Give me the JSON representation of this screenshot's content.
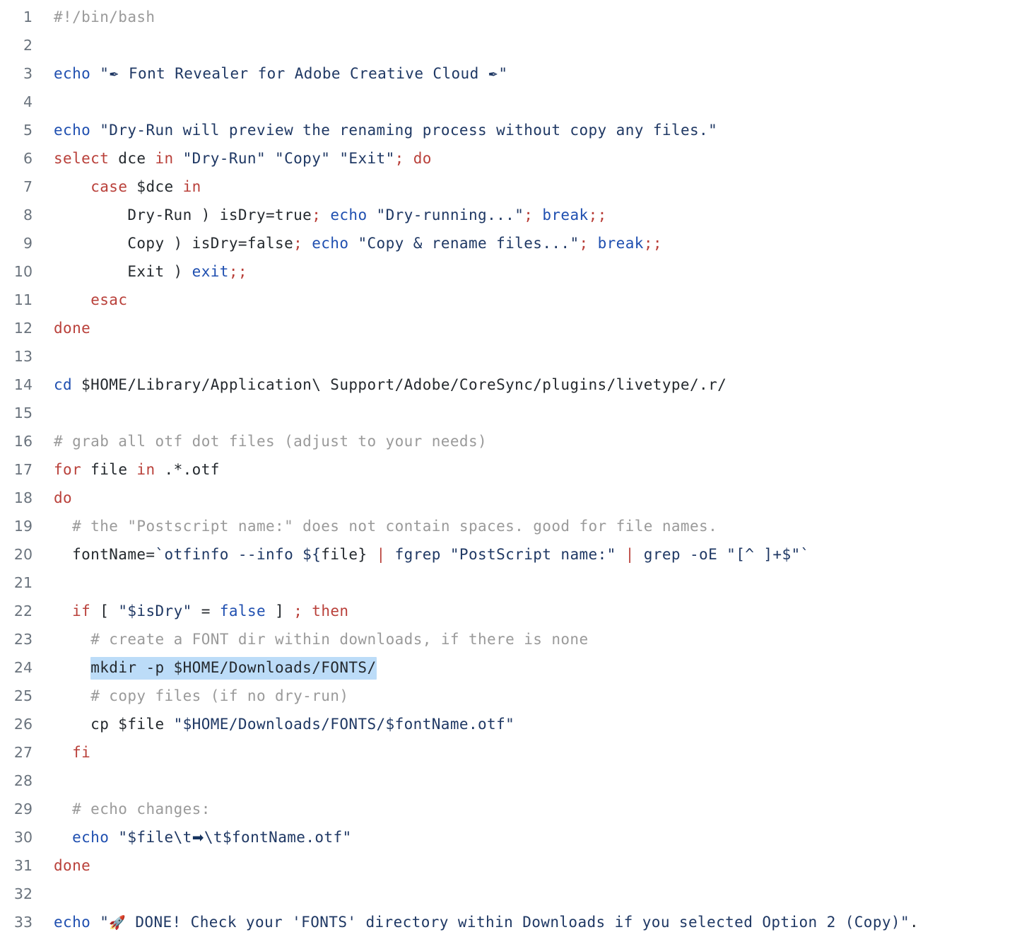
{
  "editor": {
    "name": "code-snippet-viewer",
    "language": "bash",
    "background_color": "#ffffff",
    "gutter_color": "#6a737d",
    "selection_color": "#bcdcf8",
    "colors": {
      "keyword": "#b9403a",
      "builtin": "#1f4fb0",
      "string": "#1f3864",
      "comment": "#9a9a9a",
      "plain": "#24292e",
      "punctuation": "#b9403a"
    },
    "selected_line": 24,
    "total_lines": 33
  },
  "lines": [
    {
      "n": "1",
      "text": "#!/bin/bash"
    },
    {
      "n": "2",
      "text": ""
    },
    {
      "n": "3",
      "text": "echo \"✒ Font Revealer for Adobe Creative Cloud ✒\""
    },
    {
      "n": "4",
      "text": ""
    },
    {
      "n": "5",
      "text": "echo \"Dry-Run will preview the renaming process without copy any files.\""
    },
    {
      "n": "6",
      "text": "select dce in \"Dry-Run\" \"Copy\" \"Exit\"; do"
    },
    {
      "n": "7",
      "text": "    case $dce in"
    },
    {
      "n": "8",
      "text": "        Dry-Run ) isDry=true; echo \"Dry-running...\"; break;;"
    },
    {
      "n": "9",
      "text": "        Copy ) isDry=false; echo \"Copy & rename files...\"; break;;"
    },
    {
      "n": "10",
      "text": "        Exit ) exit;;"
    },
    {
      "n": "11",
      "text": "    esac"
    },
    {
      "n": "12",
      "text": "done"
    },
    {
      "n": "13",
      "text": ""
    },
    {
      "n": "14",
      "text": "cd $HOME/Library/Application\\ Support/Adobe/CoreSync/plugins/livetype/.r/"
    },
    {
      "n": "15",
      "text": ""
    },
    {
      "n": "16",
      "text": "# grab all otf dot files (adjust to your needs)"
    },
    {
      "n": "17",
      "text": "for file in .*.otf"
    },
    {
      "n": "18",
      "text": "do"
    },
    {
      "n": "19",
      "text": "  # the \"Postscript name:\" does not contain spaces. good for file names."
    },
    {
      "n": "20",
      "text": "  fontName=`otfinfo --info ${file} | fgrep \"PostScript name:\" | grep -oE \"[^ ]+$\"`"
    },
    {
      "n": "21",
      "text": ""
    },
    {
      "n": "22",
      "text": "  if [ \"$isDry\" = false ] ; then"
    },
    {
      "n": "23",
      "text": "    # create a FONT dir within downloads, if there is none"
    },
    {
      "n": "24",
      "text": "    mkdir -p $HOME/Downloads/FONTS/"
    },
    {
      "n": "25",
      "text": "    # copy files (if no dry-run)"
    },
    {
      "n": "26",
      "text": "    cp $file \"$HOME/Downloads/FONTS/$fontName.otf\""
    },
    {
      "n": "27",
      "text": "  fi"
    },
    {
      "n": "28",
      "text": ""
    },
    {
      "n": "29",
      "text": "  # echo changes:"
    },
    {
      "n": "30",
      "text": "  echo \"$file\\t➡\\t$fontName.otf\""
    },
    {
      "n": "31",
      "text": "done"
    },
    {
      "n": "32",
      "text": ""
    },
    {
      "n": "33",
      "text": "echo \"🚀 DONE! Check your 'FONTS' directory within Downloads if you selected Option 2 (Copy)\"."
    }
  ],
  "line_numbers": [
    "1",
    "2",
    "3",
    "4",
    "5",
    "6",
    "7",
    "8",
    "9",
    "10",
    "11",
    "12",
    "13",
    "14",
    "15",
    "16",
    "17",
    "18",
    "19",
    "20",
    "21",
    "22",
    "23",
    "24",
    "25",
    "26",
    "27",
    "28",
    "29",
    "30",
    "31",
    "32",
    "33"
  ],
  "tokens": {
    "keywords": [
      "select",
      "in",
      "do",
      "case",
      "esac",
      "done",
      "for",
      "if",
      "then",
      "fi"
    ],
    "builtins": [
      "echo",
      "cd",
      "break",
      "exit",
      "false"
    ],
    "emoji": {
      "pen": "✒",
      "arrow_right": "➡",
      "rocket": "🚀"
    }
  }
}
